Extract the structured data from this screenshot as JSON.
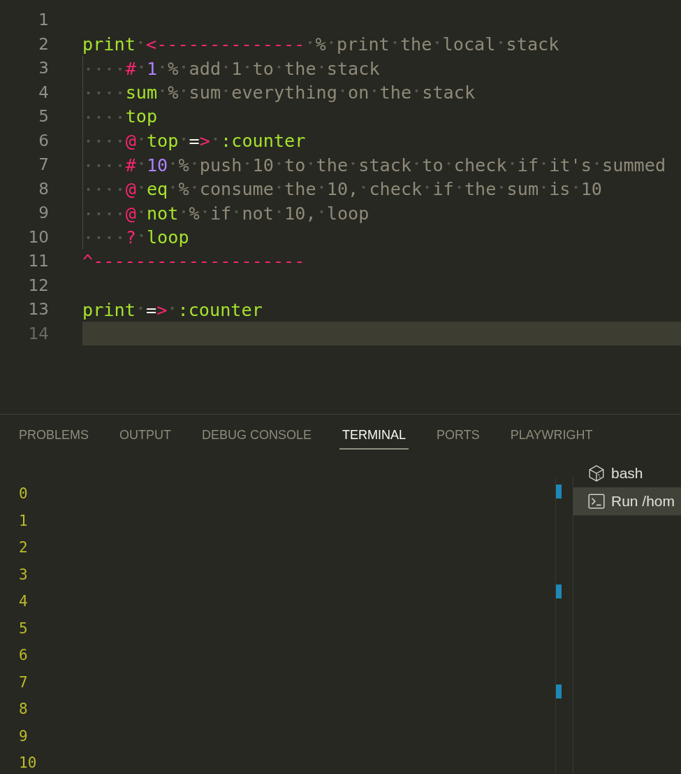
{
  "editor": {
    "lines": [
      {
        "number": "1",
        "indented": false,
        "current": false
      },
      {
        "number": "2",
        "indented": false,
        "current": false,
        "tokens": [
          {
            "kind": "keyword",
            "text": "print "
          },
          {
            "kind": "operator",
            "text": "<-------------- "
          },
          {
            "kind": "comment",
            "text": "% print the local stack"
          }
        ]
      },
      {
        "number": "3",
        "indented": true,
        "current": false,
        "tokens": [
          {
            "kind": "operator",
            "text": "# "
          },
          {
            "kind": "number",
            "text": "1 "
          },
          {
            "kind": "comment",
            "text": "% add 1 to the stack"
          }
        ]
      },
      {
        "number": "4",
        "indented": true,
        "current": false,
        "tokens": [
          {
            "kind": "keyword",
            "text": "sum "
          },
          {
            "kind": "comment",
            "text": "% sum everything on the stack"
          }
        ]
      },
      {
        "number": "5",
        "indented": true,
        "current": false,
        "tokens": [
          {
            "kind": "keyword",
            "text": "top"
          }
        ]
      },
      {
        "number": "6",
        "indented": true,
        "current": false,
        "tokens": [
          {
            "kind": "operator",
            "text": "@ "
          },
          {
            "kind": "keyword",
            "text": "top "
          },
          {
            "kind": "plain",
            "text": "="
          },
          {
            "kind": "operator",
            "text": "> "
          },
          {
            "kind": "keyword",
            "text": ":counter"
          }
        ]
      },
      {
        "number": "7",
        "indented": true,
        "current": false,
        "tokens": [
          {
            "kind": "operator",
            "text": "# "
          },
          {
            "kind": "number",
            "text": "10 "
          },
          {
            "kind": "comment",
            "text": "% push 10 to the stack to check if it's summed"
          }
        ]
      },
      {
        "number": "8",
        "indented": true,
        "current": false,
        "tokens": [
          {
            "kind": "operator",
            "text": "@ "
          },
          {
            "kind": "keyword",
            "text": "eq "
          },
          {
            "kind": "comment",
            "text": "% consume the 10, check if the sum is 10"
          }
        ]
      },
      {
        "number": "9",
        "indented": true,
        "current": false,
        "tokens": [
          {
            "kind": "operator",
            "text": "@ "
          },
          {
            "kind": "keyword",
            "text": "not "
          },
          {
            "kind": "comment",
            "text": "% if not 10, loop"
          }
        ]
      },
      {
        "number": "10",
        "indented": true,
        "current": false,
        "tokens": [
          {
            "kind": "operator",
            "text": "? "
          },
          {
            "kind": "keyword",
            "text": "loop"
          }
        ]
      },
      {
        "number": "11",
        "indented": false,
        "current": false,
        "tokens": [
          {
            "kind": "operator",
            "text": "^--------------------"
          }
        ]
      },
      {
        "number": "12",
        "indented": false,
        "current": false
      },
      {
        "number": "13",
        "indented": false,
        "current": false,
        "tokens": [
          {
            "kind": "keyword",
            "text": "print "
          },
          {
            "kind": "plain",
            "text": "="
          },
          {
            "kind": "operator",
            "text": "> "
          },
          {
            "kind": "keyword",
            "text": ":counter"
          }
        ]
      },
      {
        "number": "14",
        "indented": false,
        "current": true
      }
    ]
  },
  "panel": {
    "tabs": [
      {
        "label": "PROBLEMS",
        "selected": false
      },
      {
        "label": "OUTPUT",
        "selected": false
      },
      {
        "label": "DEBUG CONSOLE",
        "selected": false
      },
      {
        "label": "TERMINAL",
        "selected": true
      },
      {
        "label": "PORTS",
        "selected": false
      },
      {
        "label": "PLAYWRIGHT",
        "selected": false
      }
    ],
    "terminal_output": [
      "0",
      "1",
      "2",
      "3",
      "4",
      "5",
      "6",
      "7",
      "8",
      "9",
      "10"
    ],
    "terminals": [
      {
        "kind": "shell",
        "label": "bash",
        "selected": false
      },
      {
        "kind": "task",
        "label": "Run /hom",
        "selected": true
      }
    ]
  }
}
